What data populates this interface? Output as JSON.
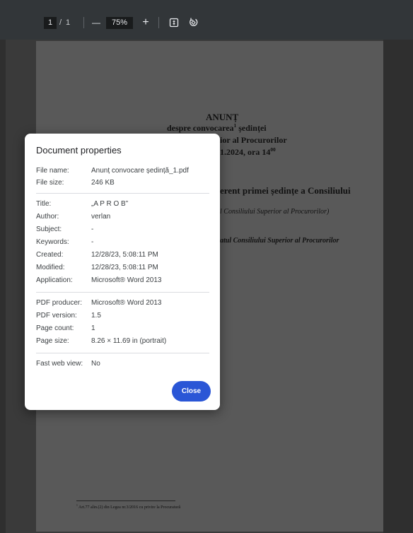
{
  "toolbar": {
    "page_current": "1",
    "page_separator": "/",
    "page_total": "1",
    "zoom_out_glyph": "—",
    "zoom_level": "75%",
    "zoom_in_glyph": "+",
    "icons": [
      "fit-page-icon",
      "rotate-icon"
    ]
  },
  "document": {
    "heading": "ANUNȚ",
    "subtitle_1": "despre convocarea",
    "footnote_marker": "1",
    "subtitle_1_end": " ședinței",
    "subtitle_2": "ior al Procurorilor",
    "date_line": "1.2024, ora 14",
    "time_superscript": "00",
    "agenda_line": "erent primei ședințe a Consiliului",
    "italic_line_1": "l Consiliului Superior al Procurorilor)",
    "italic_line_2": "atul Consiliului Superior al Procurorilor",
    "footnote_text_marker": "1",
    "footnote_text": " Art.77 alin.(2) din Legea nr.3/2016 cu privire la Procuratură"
  },
  "dialog": {
    "title": "Document properties",
    "groups": [
      [
        {
          "label": "File name:",
          "value": "Anunț convocare ședință_1.pdf"
        },
        {
          "label": "File size:",
          "value": "246 KB"
        }
      ],
      [
        {
          "label": "Title:",
          "value": "„A P R O B”"
        },
        {
          "label": "Author:",
          "value": "verlan"
        },
        {
          "label": "Subject:",
          "value": "-"
        },
        {
          "label": "Keywords:",
          "value": "-"
        },
        {
          "label": "Created:",
          "value": "12/28/23, 5:08:11 PM"
        },
        {
          "label": "Modified:",
          "value": "12/28/23, 5:08:11 PM"
        },
        {
          "label": "Application:",
          "value": "Microsoft® Word 2013"
        }
      ],
      [
        {
          "label": "PDF producer:",
          "value": "Microsoft® Word 2013"
        },
        {
          "label": "PDF version:",
          "value": "1.5"
        },
        {
          "label": "Page count:",
          "value": "1"
        },
        {
          "label": "Page size:",
          "value": "8.26 × 11.69 in (portrait)"
        }
      ],
      [
        {
          "label": "Fast web view:",
          "value": "No"
        }
      ]
    ],
    "close_label": "Close"
  },
  "colors": {
    "toolbar_bg": "#323639",
    "page_dim": "#595959",
    "primary_button": "#2a56d6"
  }
}
